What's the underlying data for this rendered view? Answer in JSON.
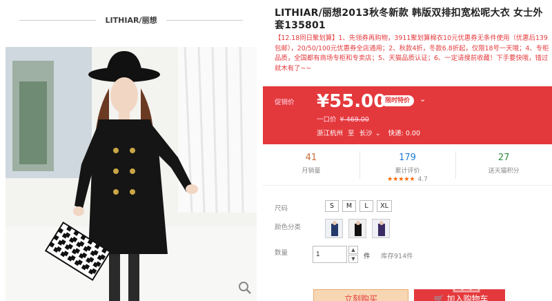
{
  "gallery": {
    "brand": "LITHIAR/丽想"
  },
  "product": {
    "title": "LITHIAR/丽想2013秋冬新款 韩版双排扣宽松呢大衣 女士外套135801",
    "promo": "【12.18同日聚划算】1、先领券再购物，3911聚划算棉衣10元优惠券无条件使用（优惠后139包邮），20/50/100元优惠券全店通用；2、秋款4折，冬款6.8折起，仅限18号一天哦；4、专柜品质，全国都有商场专柜和专卖店；5、天猫品质认证；6、一定请搜前收藏！下手要快哦，错过就木有了~~"
  },
  "price": {
    "label": "促销价",
    "current": "¥55.00",
    "badge": "限时特价",
    "original_label": "一口价",
    "original_value": "¥ 469.00",
    "ship_from": "浙江杭州",
    "ship_to_prefix": "至",
    "ship_to": "长沙",
    "delivery": "快递: 0.00"
  },
  "stats": {
    "sales_num": "41",
    "sales_label": "月销量",
    "reviews_num": "179",
    "reviews_label": "累计评价",
    "rating": "4.7",
    "points_num": "27",
    "points_label": "送天猫积分"
  },
  "options": {
    "size_label": "尺码",
    "sizes": [
      "S",
      "M",
      "L",
      "XL"
    ],
    "color_label": "颜色分类",
    "qty_label": "数量",
    "qty_value": "1",
    "qty_unit": "件",
    "stock": "库存914件"
  },
  "actions": {
    "buy_now": "立刻购买",
    "add_to_cart": "加入购物车"
  },
  "watermark": {
    "text": "08素材",
    "sub": "08WOJ.COM"
  },
  "colors": {
    "accent": "#e4393c",
    "sales": "#c96d3a",
    "reviews": "#1f7ad6",
    "points": "#2d8b3e"
  }
}
